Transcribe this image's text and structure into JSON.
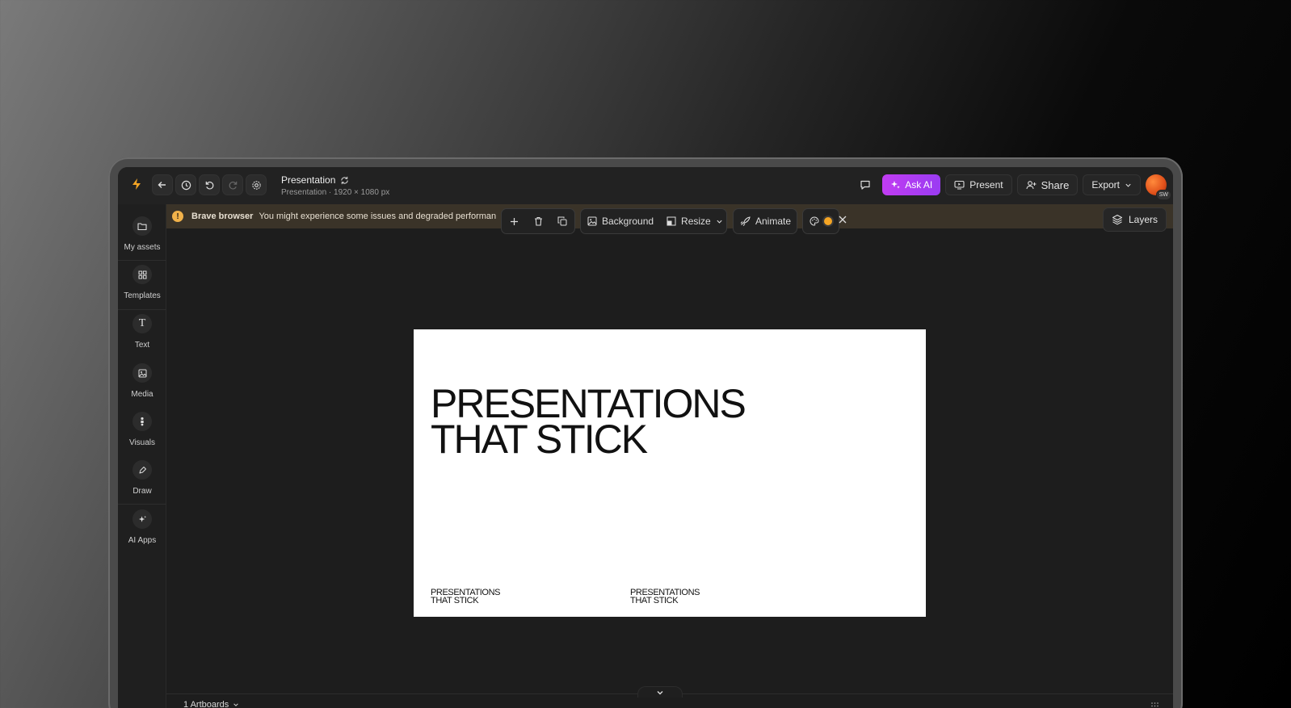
{
  "app": {
    "doc_title": "Presentation",
    "doc_subtitle": "Presentation · 1920 × 1080 px",
    "accent_color": "#f5a524"
  },
  "header": {
    "ask_ai_label": "Ask AI",
    "present_label": "Present",
    "share_label": "Share",
    "export_label": "Export",
    "avatar_initials": "SW"
  },
  "sidebar": {
    "items": [
      {
        "label": "My assets",
        "icon": "folder-icon"
      },
      {
        "label": "Templates",
        "icon": "grid-icon"
      },
      {
        "label": "Text",
        "icon": "text-icon"
      },
      {
        "label": "Media",
        "icon": "image-icon"
      },
      {
        "label": "Visuals",
        "icon": "shapes-icon"
      },
      {
        "label": "Draw",
        "icon": "pen-icon"
      },
      {
        "label": "AI Apps",
        "icon": "sparkle-icon"
      }
    ]
  },
  "banner": {
    "title": "Brave browser",
    "message": "You might experience some issues and degraded performan"
  },
  "toolbar": {
    "background_label": "Background",
    "resize_label": "Resize",
    "animate_label": "Animate"
  },
  "layers_label": "Layers",
  "canvas": {
    "headline_line1": "PRESENTATIONS",
    "headline_line2": "THAT STICK",
    "footer_left_line1": "PRESENTATIONS",
    "footer_left_line2": "THAT STICK",
    "footer_right_line1": "PRESENTATIONS",
    "footer_right_line2": "THAT STICK"
  },
  "footer": {
    "artboards_label": "1 Artboards"
  }
}
